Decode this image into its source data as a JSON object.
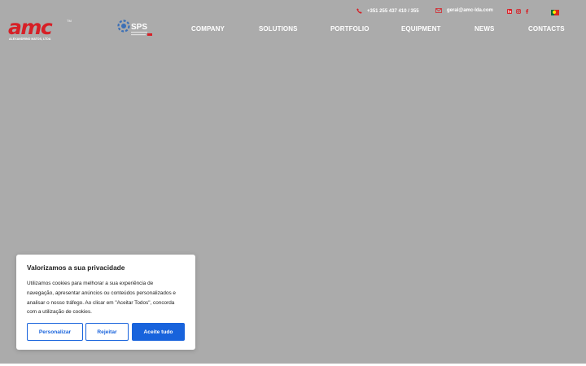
{
  "colors": {
    "page_background": "#ababab",
    "brand_red": "#d71f26",
    "accent_blue": "#1863dc",
    "text_white": "#ffffff",
    "text_dark": "#212121"
  },
  "header": {
    "logo": {
      "text": "amc",
      "tagline": "ALEXANDRINO MATOS, LTDA",
      "trademark": "TM"
    },
    "partner_logo": {
      "text": "SPS"
    },
    "contact": {
      "phone_icon": "phone-icon",
      "phone": "+351 255 437 410 / 355",
      "email_icon": "envelope-icon",
      "email": "geral@amc-lda.com"
    },
    "social": [
      "linkedin-icon",
      "instagram-icon",
      "facebook-icon"
    ],
    "language_flag": "portugal-flag-icon",
    "nav": [
      "COMPANY",
      "SOLUTIONS",
      "PORTFOLIO",
      "EQUIPMENT",
      "NEWS",
      "CONTACTS"
    ]
  },
  "cookie_banner": {
    "title": "Valorizamos a sua privacidade",
    "body": "Utilizamos cookies para melhorar a sua experiência de navegação, apresentar anúncios ou conteúdos personalizados e analisar o nosso tráfego. Ao clicar em \"Aceitar Todos\", concorda com a utilização de cookies.",
    "customize_label": "Personalizar",
    "reject_label": "Rejeitar",
    "accept_label": "Aceite tudo"
  }
}
